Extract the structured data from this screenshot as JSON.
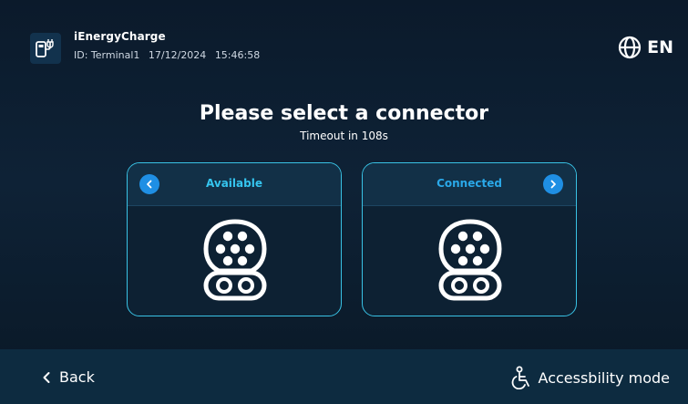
{
  "header": {
    "app_name": "iEnergyCharge",
    "terminal_id": "ID: Terminal1",
    "date": "17/12/2024",
    "time": "15:46:58",
    "language": "EN",
    "icons": {
      "logo": "charger-plug-icon",
      "language": "globe-icon"
    }
  },
  "main": {
    "title": "Please select a connector",
    "subtitle": "Timeout in 108s"
  },
  "connectors": [
    {
      "status": "Available",
      "nav": "chevron-left-icon",
      "icon": "ccs-connector-icon"
    },
    {
      "status": "Connected",
      "nav": "chevron-right-icon",
      "icon": "ccs-connector-icon"
    }
  ],
  "footer": {
    "back_label": "Back",
    "accessibility_label": "Accessbility mode",
    "icons": {
      "back": "chevron-left-icon",
      "accessibility": "wheelchair-icon"
    }
  },
  "colors": {
    "background": "#0b1a2b",
    "accent": "#39c2e5",
    "nav_button": "#1f8fe4",
    "footer": "#0d2b40"
  }
}
